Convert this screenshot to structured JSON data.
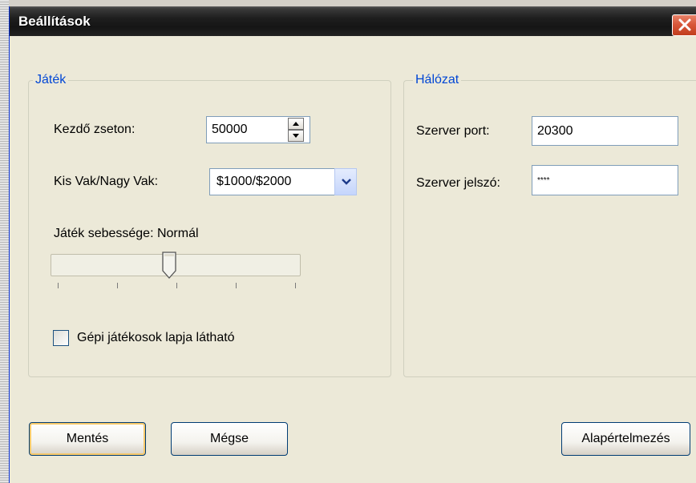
{
  "window": {
    "title": "Beállítások",
    "close_icon": "close-icon"
  },
  "game_group": {
    "legend": "Játék",
    "starting_chips_label": "Kezdő zseton:",
    "starting_chips_value": "50000",
    "blinds_label": "Kis Vak/Nagy Vak:",
    "blinds_selected": "$1000/$2000",
    "speed_label": "Játék sebessége: Normál",
    "speed_level_index": 2,
    "speed_levels_count": 5,
    "cpu_cards_label": "Gépi játékosok lapja látható",
    "cpu_cards_checked": false
  },
  "network_group": {
    "legend": "Hálózat",
    "server_port_label": "Szerver port:",
    "server_port_value": "20300",
    "server_password_label": "Szerver jelszó:",
    "server_password_value": "****"
  },
  "buttons": {
    "save_label": "Mentés",
    "cancel_label": "Mégse",
    "defaults_label": "Alapértelmezés"
  },
  "colors": {
    "legend": "#0046d5",
    "close_button": "#d9573a",
    "title_bar": "#1e1e1e"
  }
}
